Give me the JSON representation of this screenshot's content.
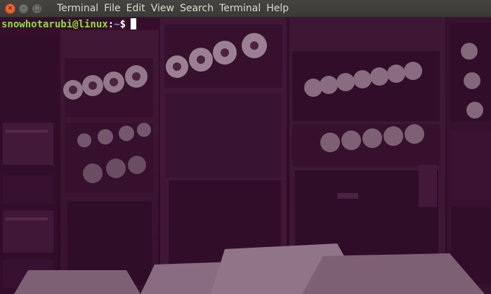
{
  "window": {
    "controls": {
      "close_icon": "×",
      "minimize_icon": "–",
      "maximize_icon": "□"
    }
  },
  "menu": {
    "items": [
      "Terminal",
      "File",
      "Edit",
      "View",
      "Search",
      "Terminal",
      "Help"
    ]
  },
  "terminal": {
    "prompt_user_host": "snowhotarubi@linux",
    "prompt_colon": ":",
    "prompt_path": "~",
    "prompt_symbol": "$",
    "colors": {
      "user_host": "#8ae234",
      "path": "#729fcf",
      "background": "#300a24",
      "cursor": "#ffffff"
    },
    "background_image": "vintage-mainframe-tape-drives"
  }
}
